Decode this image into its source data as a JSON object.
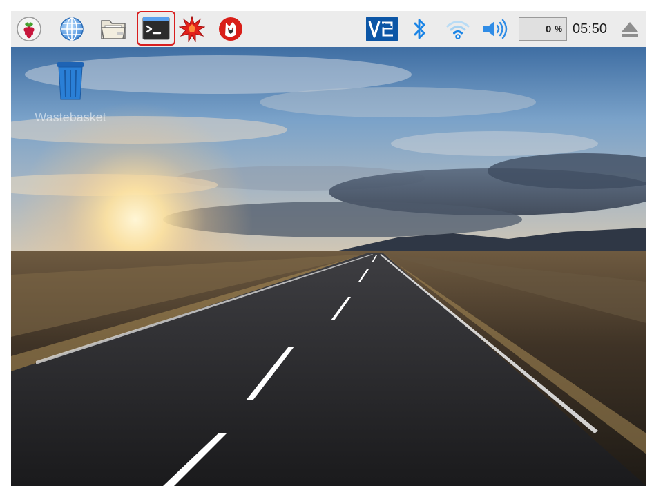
{
  "taskbar": {
    "launchers": [
      {
        "name": "raspberry-menu",
        "icon": "raspberry-icon"
      },
      {
        "name": "web-browser",
        "icon": "globe-icon"
      },
      {
        "name": "file-manager",
        "icon": "folder-icon"
      },
      {
        "name": "terminal",
        "icon": "terminal-icon",
        "highlighted": true
      },
      {
        "name": "mathematica",
        "icon": "spikey-icon"
      },
      {
        "name": "wolfram",
        "icon": "wolf-icon"
      }
    ],
    "tray": {
      "vnc_icon": "vnc-icon",
      "bluetooth_icon": "bluetooth-icon",
      "wifi_icon": "wifi-icon",
      "volume_icon": "speaker-icon",
      "cpu_value": "0",
      "cpu_unit": "%",
      "clock": "05:50",
      "eject_icon": "eject-icon"
    }
  },
  "desktop": {
    "wallpaper": "open-road-at-sunset",
    "icons": [
      {
        "name": "wastebasket",
        "label": "Wastebasket",
        "icon": "trash-icon"
      }
    ]
  },
  "colors": {
    "taskbar_bg": "#ececec",
    "highlight_border": "#d81e1e",
    "tray_blue": "#1a84e6",
    "vnc_bg": "#0c56a6"
  }
}
